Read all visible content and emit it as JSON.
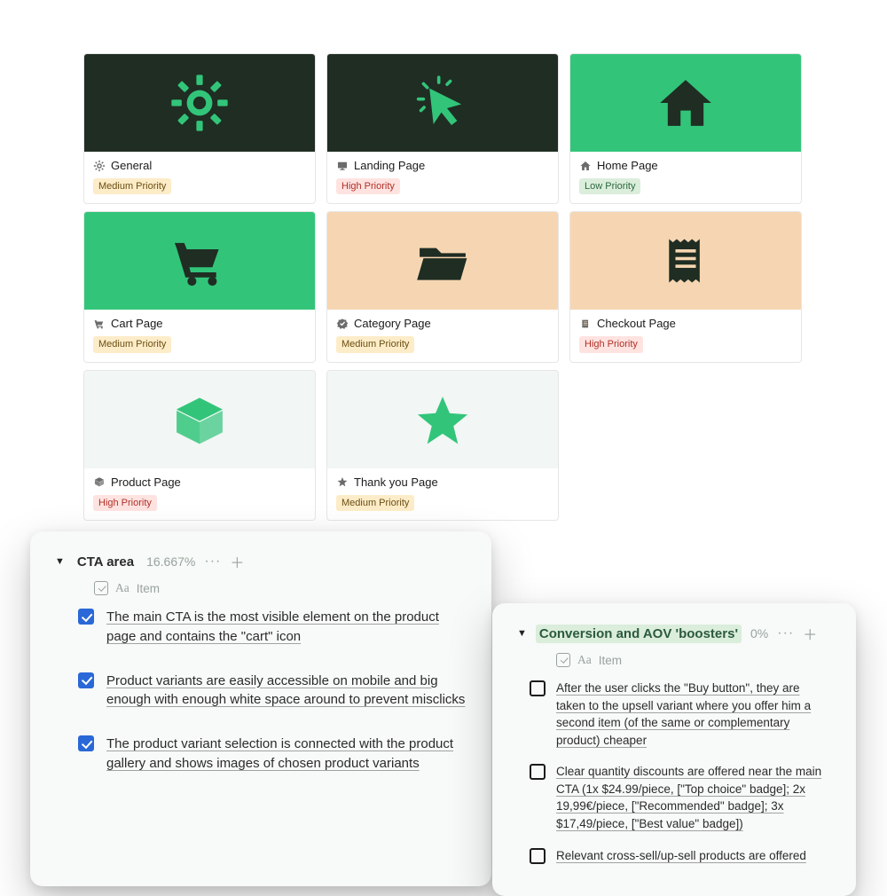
{
  "cards": [
    {
      "title": "General",
      "priority": "Medium Priority",
      "priority_level": "medium",
      "hero_bg": "dark",
      "icon": "gear",
      "hero_icon_color": "#32c57a",
      "title_icon_color": "#6b6b6b"
    },
    {
      "title": "Landing Page",
      "priority": "High Priority",
      "priority_level": "high",
      "hero_bg": "dark",
      "icon": "cursor",
      "hero_icon_color": "#32c57a",
      "title_icon_color": "#6b6b6b"
    },
    {
      "title": "Home Page",
      "priority": "Low Priority",
      "priority_level": "low",
      "hero_bg": "green",
      "icon": "home",
      "hero_icon_color": "#1f2d23",
      "title_icon_color": "#6b6b6b"
    },
    {
      "title": "Cart Page",
      "priority": "Medium Priority",
      "priority_level": "medium",
      "hero_bg": "green",
      "icon": "cart",
      "hero_icon_color": "#1f2d23",
      "title_icon_color": "#6b6b6b"
    },
    {
      "title": "Category Page",
      "priority": "Medium Priority",
      "priority_level": "medium",
      "hero_bg": "peach",
      "icon": "folder",
      "hero_icon_color": "#1f2d23",
      "title_icon_color": "#6b6b6b"
    },
    {
      "title": "Checkout Page",
      "priority": "High Priority",
      "priority_level": "high",
      "hero_bg": "peach",
      "icon": "receipt",
      "hero_icon_color": "#1f2d23",
      "title_icon_color": "#6b6b6b"
    },
    {
      "title": "Product Page",
      "priority": "High Priority",
      "priority_level": "high",
      "hero_bg": "light",
      "icon": "box",
      "hero_icon_color": "#32c57a",
      "title_icon_color": "#6b6b6b"
    },
    {
      "title": "Thank you Page",
      "priority": "Medium Priority",
      "priority_level": "medium",
      "hero_bg": "light",
      "icon": "star",
      "hero_icon_color": "#32c57a",
      "title_icon_color": "#6b6b6b"
    }
  ],
  "panel_left": {
    "title": "CTA area",
    "percent": "16.667%",
    "column_label": "Item",
    "items": [
      {
        "checked": true,
        "text": "The main CTA is the most visible element on the product page and contains the \"cart\" icon"
      },
      {
        "checked": true,
        "text": "Product variants are easily accessible on mobile and big enough with enough white space around to prevent misclicks"
      },
      {
        "checked": true,
        "text": "The product variant selection is connected with the product gallery and shows images of chosen product variants"
      }
    ]
  },
  "panel_right": {
    "title": "Conversion and AOV 'boosters'",
    "percent": "0%",
    "column_label": "Item",
    "items": [
      {
        "checked": false,
        "text": "After the user clicks the \"Buy button\", they are taken to the upsell variant where you offer him a second item (of the same or complementary product) cheaper"
      },
      {
        "checked": false,
        "text": "Clear quantity discounts are offered near the main CTA (1x $24.99/piece, [\"Top choice\" badge]; 2x 19,99€/piece, [\"Recommended\" badge]; 3x $17,49/piece, [\"Best value\" badge])"
      },
      {
        "checked": false,
        "text": "Relevant cross-sell/up-sell products are offered"
      }
    ]
  }
}
